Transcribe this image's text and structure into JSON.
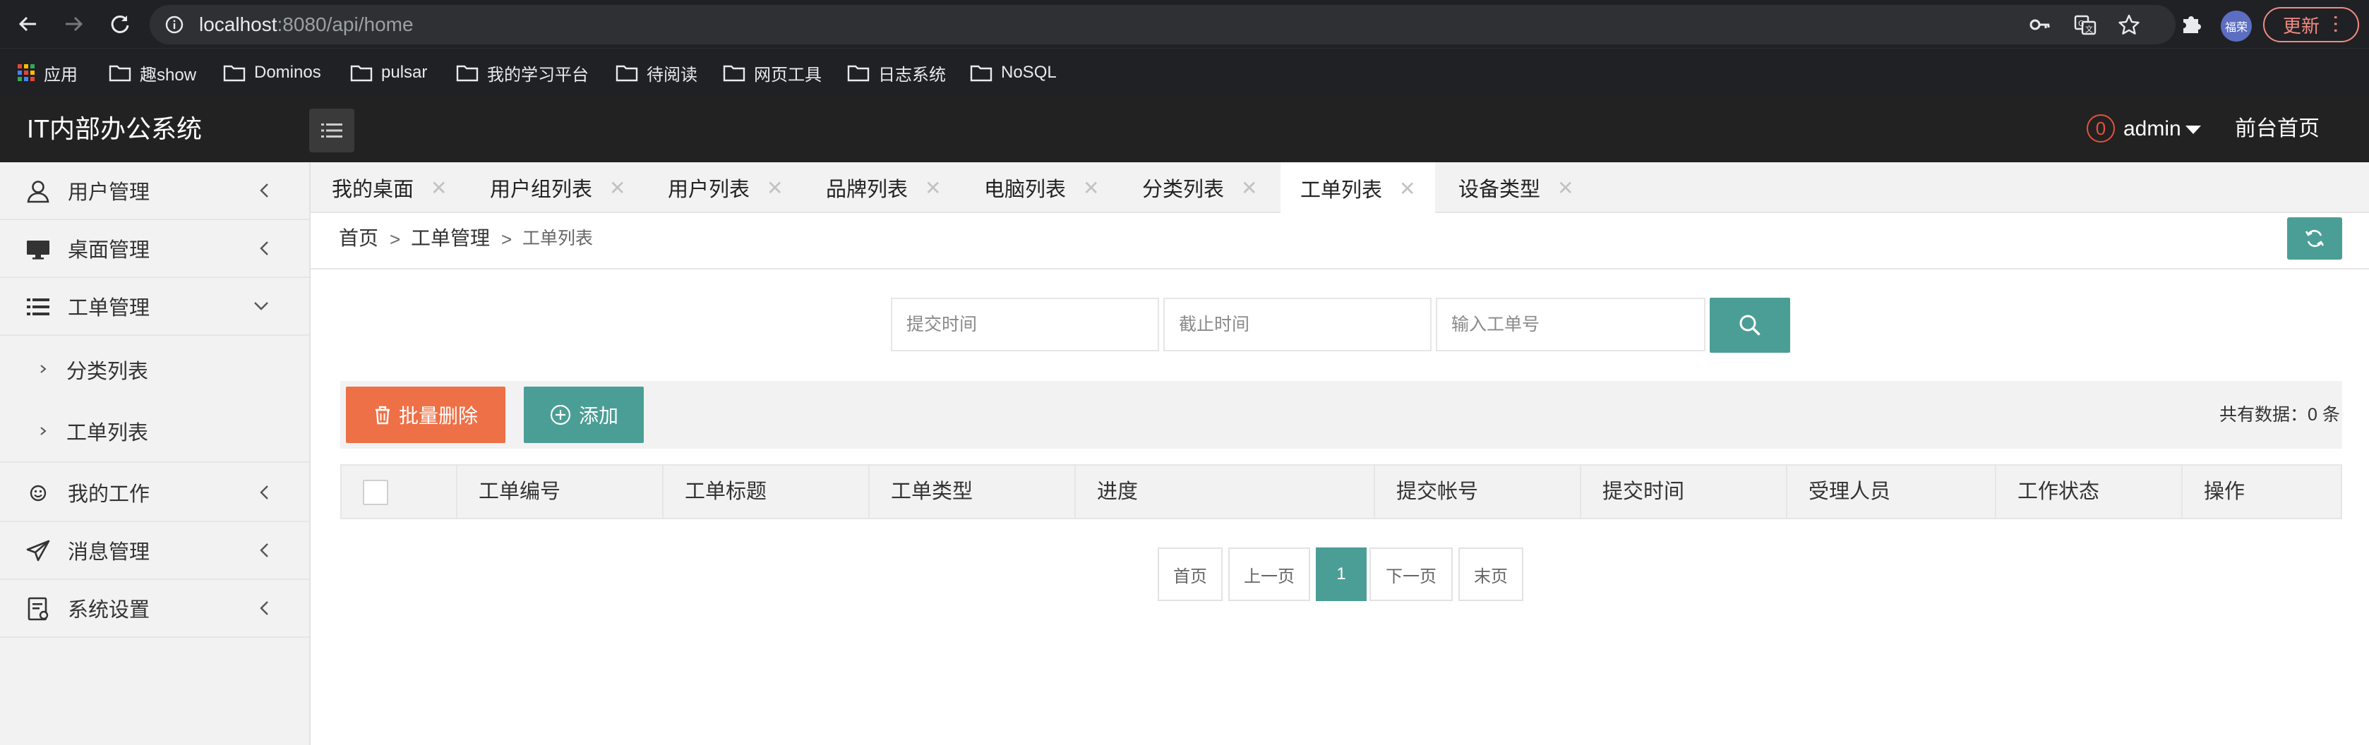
{
  "browser": {
    "url_host": "localhost",
    "url_path": ":8080/api/home",
    "profile_label": "福荣",
    "update_label": "更新",
    "bookmarks": [
      "应用",
      "趣show",
      "Dominos",
      "pulsar",
      "我的学习平台",
      "待阅读",
      "网页工具",
      "日志系统",
      "NoSQL"
    ]
  },
  "header": {
    "title": "IT内部办公系统",
    "badge_count": "0",
    "user": "admin",
    "front_home": "前台首页"
  },
  "sidebar": {
    "items": [
      {
        "label": "用户管理",
        "icon": "user-icon"
      },
      {
        "label": "桌面管理",
        "icon": "desktop-icon"
      },
      {
        "label": "工单管理",
        "icon": "list-icon"
      },
      {
        "label": "分类列表"
      },
      {
        "label": "工单列表"
      },
      {
        "label": "我的工作",
        "icon": "smile-icon"
      },
      {
        "label": "消息管理",
        "icon": "paper-plane-icon"
      },
      {
        "label": "系统设置",
        "icon": "settings-doc-icon"
      }
    ]
  },
  "tabs": [
    "我的桌面",
    "用户组列表",
    "用户列表",
    "品牌列表",
    "电脑列表",
    "分类列表",
    "工单列表",
    "设备类型"
  ],
  "active_tab": "工单列表",
  "breadcrumb": [
    "首页",
    "工单管理",
    "工单列表"
  ],
  "search": {
    "start_placeholder": "提交时间",
    "end_placeholder": "截止时间",
    "order_placeholder": "输入工单号"
  },
  "toolbar": {
    "batch_delete": "批量删除",
    "add": "添加",
    "total_label": "共有数据：",
    "total_count": "0",
    "total_unit": "条"
  },
  "table": {
    "columns": [
      "工单编号",
      "工单标题",
      "工单类型",
      "进度",
      "提交帐号",
      "提交时间",
      "受理人员",
      "工作状态",
      "操作"
    ]
  },
  "pagination": {
    "first": "首页",
    "prev": "上一页",
    "current": "1",
    "next": "下一页",
    "last": "末页"
  },
  "colors": {
    "primary": "#4b9e96",
    "danger": "#ee7046",
    "header_bg": "#222222"
  }
}
